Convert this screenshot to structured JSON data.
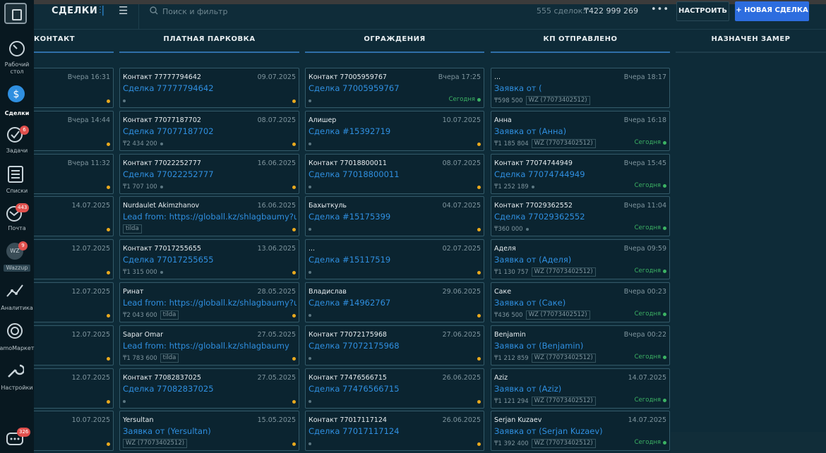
{
  "sidebar": {
    "items": [
      {
        "label": "Рабочий стол",
        "icon": "dashboard-icon"
      },
      {
        "label": "Сделки",
        "icon": "deals-icon",
        "active": true
      },
      {
        "label": "Задачи",
        "icon": "tasks-icon",
        "badge": "6"
      },
      {
        "label": "Списки",
        "icon": "lists-icon"
      },
      {
        "label": "Почта",
        "icon": "mail-icon",
        "badge": "443"
      },
      {
        "label": "Wazzup",
        "icon": "wazzup-icon",
        "badge": "9",
        "avatar_text": "WZ"
      },
      {
        "label": "Аналитика",
        "icon": "analytics-icon"
      },
      {
        "label": "amoМаркет",
        "icon": "market-icon"
      },
      {
        "label": "Настройки",
        "icon": "settings-icon"
      },
      {
        "label": "",
        "icon": "chat-icon",
        "badge": "326"
      }
    ]
  },
  "header": {
    "title": "СДЕЛКИ",
    "search_placeholder": "Поиск и фильтр",
    "deal_count": "555 сделок:",
    "deal_sum": "₸422 999 269",
    "more_label": "•••",
    "setup_label": "НАСТРОИТЬ",
    "new_deal_label": "+ НОВАЯ СДЕЛКА"
  },
  "colors": {
    "accent": "#2f8fe0",
    "primary_button": "#2d6ddf",
    "status_green": "#3cb364",
    "status_yellow": "#e9a91d"
  },
  "columns": [
    {
      "title": "КОНТАКТ",
      "cards": [
        {
          "contact": "",
          "date": "Вчера 16:31",
          "deal": ")",
          "dot": "yellow"
        },
        {
          "contact": "",
          "date": "Вчера 14:44",
          "deal": "",
          "dot": "yellow"
        },
        {
          "contact": "",
          "date": "Вчера 11:32",
          "deal": "",
          "dot": "yellow"
        },
        {
          "contact": "",
          "date": "14.07.2025",
          "deal": "",
          "dot": "yellow"
        },
        {
          "contact": "",
          "date": "12.07.2025",
          "deal": "",
          "dot": "yellow"
        },
        {
          "contact": "",
          "date": "12.07.2025",
          "deal": "",
          "dot": "yellow"
        },
        {
          "contact": "",
          "date": "12.07.2025",
          "deal": "",
          "dot": "yellow"
        },
        {
          "contact": "",
          "date": "12.07.2025",
          "deal": "",
          "dot": "yellow"
        },
        {
          "contact": "",
          "date": "10.07.2025",
          "deal": "",
          "dot": "yellow"
        }
      ]
    },
    {
      "title": "ПЛАТНАЯ ПАРКОВКА",
      "cards": [
        {
          "contact": "Контакт 77777794642",
          "date": "09.07.2025",
          "deal": "Сделка 77777794642",
          "price": "",
          "tag": "",
          "dot": "yellow"
        },
        {
          "contact": "Контакт 77077187702",
          "date": "08.07.2025",
          "deal": "Сделка 77077187702",
          "price": "₸2 434 200",
          "tag": "",
          "dot": "yellow"
        },
        {
          "contact": "Контакт 77022252777",
          "date": "16.06.2025",
          "deal": "Сделка 77022252777",
          "price": "₸1 707 100",
          "tag": "",
          "dot": "yellow"
        },
        {
          "contact": "Nurdaulet Akimzhanov",
          "date": "16.06.2025",
          "deal": "Lead from: https://globall.kz/shlagbaumy?ut...",
          "price": "",
          "tag": "tilda",
          "dot": "yellow"
        },
        {
          "contact": "Контакт 77017255655",
          "date": "13.06.2025",
          "deal": "Сделка 77017255655",
          "price": "₸1 315 000",
          "tag": "",
          "dot": "yellow"
        },
        {
          "contact": "Ринат",
          "date": "28.05.2025",
          "deal": "Lead from: https://globall.kz/shlagbaumy?ut...",
          "price": "₸2 043 600",
          "tag": "tilda",
          "dot": "yellow"
        },
        {
          "contact": "Sapar Omar",
          "date": "27.05.2025",
          "deal": "Lead from: https://globall.kz/shlagbaumy",
          "price": "₸1 783 600",
          "tag": "tilda",
          "dot": "yellow"
        },
        {
          "contact": "Контакт 77082837025",
          "date": "27.05.2025",
          "deal": "Сделка 77082837025",
          "price": "",
          "tag": "",
          "dot": "yellow"
        },
        {
          "contact": "Yersultan",
          "date": "15.05.2025",
          "deal": "Заявка от (Yersultan)",
          "price": "",
          "tag": "WZ (77073402512)",
          "dot": "yellow"
        }
      ]
    },
    {
      "title": "ОГРАЖДЕНИЯ",
      "cards": [
        {
          "contact": "Контакт 77005959767",
          "date": "Вчера 17:25",
          "deal": "Сделка 77005959767",
          "price": "",
          "tag": "",
          "status": "Сегодня",
          "dot": "green"
        },
        {
          "contact": "Алишер",
          "date": "10.07.2025",
          "deal": "Сделка #15392719",
          "price": "",
          "tag": "",
          "dot": "yellow"
        },
        {
          "contact": "Контакт 77018800011",
          "date": "08.07.2025",
          "deal": "Сделка 77018800011",
          "price": "",
          "tag": "",
          "dot": "yellow"
        },
        {
          "contact": "Бахыткуль",
          "date": "04.07.2025",
          "deal": "Сделка #15175399",
          "price": "",
          "tag": "",
          "dot": "yellow"
        },
        {
          "contact": "...",
          "date": "02.07.2025",
          "deal": "Сделка #15117519",
          "price": "",
          "tag": "",
          "dot": "yellow"
        },
        {
          "contact": "Владислав",
          "date": "29.06.2025",
          "deal": "Сделка #14962767",
          "price": "",
          "tag": "",
          "dot": "yellow"
        },
        {
          "contact": "Контакт 77072175968",
          "date": "27.06.2025",
          "deal": "Сделка 77072175968",
          "price": "",
          "tag": "",
          "dot": "yellow"
        },
        {
          "contact": "Контакт 77476566715",
          "date": "26.06.2025",
          "deal": "Сделка 77476566715",
          "price": "",
          "tag": "",
          "dot": "yellow"
        },
        {
          "contact": "Контакт 77017117124",
          "date": "26.06.2025",
          "deal": "Сделка 77017117124",
          "price": "",
          "tag": "",
          "dot": "yellow"
        }
      ]
    },
    {
      "title": "КП ОТПРАВЛЕНО",
      "cards": [
        {
          "contact": "...",
          "date": "Вчера 18:17",
          "deal": "Заявка от (",
          "price": "₸598 500",
          "tag": "WZ (77073402512)",
          "dot": ""
        },
        {
          "contact": "Анна",
          "date": "Вчера 16:18",
          "deal": "Заявка от (Анна)",
          "price": "₸1 185 804",
          "tag": "WZ (77073402512)",
          "status": "Сегодня",
          "dot": "green"
        },
        {
          "contact": "Контакт 77074744949",
          "date": "Вчера 15:45",
          "deal": "Сделка 77074744949",
          "price": "₸1 252 189",
          "tag": "",
          "status": "Сегодня",
          "dot": "green"
        },
        {
          "contact": "Контакт 77029362552",
          "date": "Вчера 11:04",
          "deal": "Сделка 77029362552",
          "price": "₸360 000",
          "tag": "",
          "status": "Сегодня",
          "dot": "green"
        },
        {
          "contact": "Аделя",
          "date": "Вчера 09:59",
          "deal": "Заявка от (Аделя)",
          "price": "₸1 130 757",
          "tag": "WZ (77073402512)",
          "status": "Сегодня",
          "dot": "green"
        },
        {
          "contact": "Саке",
          "date": "Вчера 00:23",
          "deal": "Заявка от (Саке)",
          "price": "₸436 500",
          "tag": "WZ (77073402512)",
          "status": "Сегодня",
          "dot": "green"
        },
        {
          "contact": "Benjamin",
          "date": "Вчера 00:22",
          "deal": "Заявка от (Benjamin)",
          "price": "₸1 212 859",
          "tag": "WZ (77073402512)",
          "status": "Сегодня",
          "dot": "green"
        },
        {
          "contact": "Aziz",
          "date": "14.07.2025",
          "deal": "Заявка от (Aziz)",
          "price": "₸1 121 294",
          "tag": "WZ (77073402512)",
          "status": "Сегодня",
          "dot": "green"
        },
        {
          "contact": "Serjan Kuzaev",
          "date": "14.07.2025",
          "deal": "Заявка от (Serjan Kuzaev)",
          "price": "₸1 392 400",
          "tag": "WZ (77073402512)",
          "status": "Сегодня",
          "dot": "green"
        }
      ]
    },
    {
      "title": "НАЗНАЧЕН ЗАМЕР",
      "cards": []
    }
  ]
}
